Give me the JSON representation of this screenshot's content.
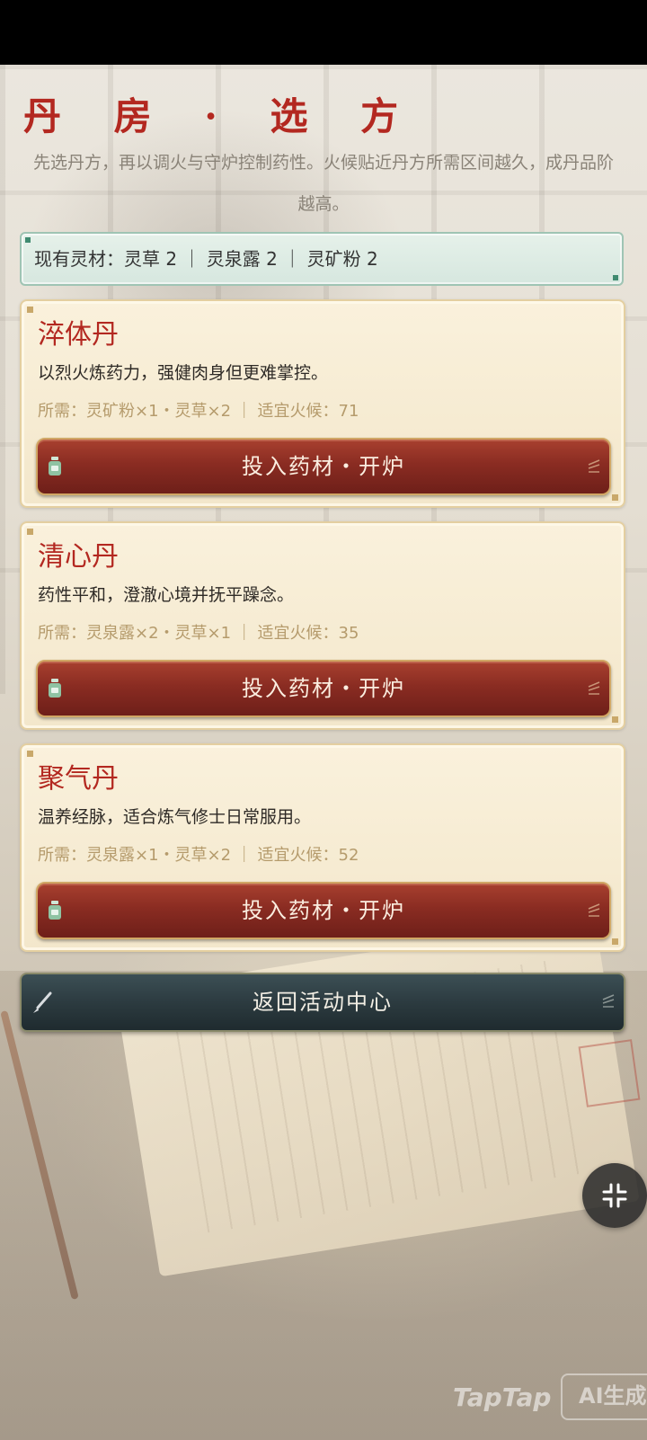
{
  "header": {
    "title": "丹 房 · 选 方",
    "intro": "先选丹方，再以调火与守炉控制药性。火候贴近丹方所需区间越久，成丹品阶越高。"
  },
  "inventory": {
    "text": "现有灵材：灵草 2 ｜ 灵泉露 2 ｜ 灵矿粉 2"
  },
  "recipes": [
    {
      "name": "淬体丹",
      "desc": "以烈火炼药力，强健肉身但更难掌控。",
      "requirement": "所需：灵矿粉×1・灵草×2 ｜ 适宜火候：71",
      "button_label": "投入药材・开炉"
    },
    {
      "name": "清心丹",
      "desc": "药性平和，澄澈心境并抚平躁念。",
      "requirement": "所需：灵泉露×2・灵草×1 ｜ 适宜火候：35",
      "button_label": "投入药材・开炉"
    },
    {
      "name": "聚气丹",
      "desc": "温养经脉，适合炼气修士日常服用。",
      "requirement": "所需：灵泉露×1・灵草×2 ｜ 适宜火候：52",
      "button_label": "投入药材・开炉"
    }
  ],
  "back_button": {
    "label": "返回活动中心"
  },
  "icons": {
    "potion": "potion-bottle-icon",
    "brush": "brush-icon",
    "exit_fullscreen": "exit-fullscreen-icon"
  },
  "colors": {
    "title_red": "#b32820",
    "button_red": "#8a2c22",
    "back_button": "#2c3b40",
    "inventory_bg": "#e6f1ea"
  },
  "watermark": {
    "text": "TapTap",
    "badge": "AI生成"
  }
}
